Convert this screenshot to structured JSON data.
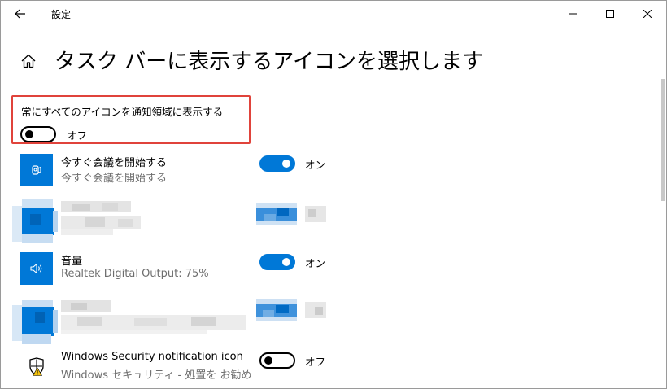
{
  "window": {
    "title": "設定"
  },
  "page": {
    "title": "タスク バーに表示するアイコンを選択します"
  },
  "always_show": {
    "label": "常にすべてのアイコンを通知領域に表示する",
    "state": "オフ",
    "enabled": false
  },
  "rows": [
    {
      "name": "今すぐ会議を開始する",
      "subtitle": "今すぐ会議を開始する",
      "state": "オン",
      "enabled": true,
      "icon": "meet-now-icon"
    },
    {
      "name": "",
      "subtitle": "",
      "state": "",
      "enabled": null,
      "icon": "pixelated-app-icon"
    },
    {
      "name": "音量",
      "subtitle": "Realtek Digital Output: 75%",
      "state": "オン",
      "enabled": true,
      "icon": "speaker-icon"
    },
    {
      "name": "",
      "subtitle": "",
      "state": "",
      "enabled": null,
      "icon": "pixelated-app-icon"
    },
    {
      "name": "Windows Security notification icon",
      "subtitle": "Windows セキュリティ - 処置を お勧めし...",
      "state": "オフ",
      "enabled": false,
      "icon": "windows-security-shield-icon"
    }
  ],
  "colors": {
    "accent": "#0078d7",
    "highlight_border": "#e0433b",
    "subtitle_text": "#6d6d6d"
  }
}
